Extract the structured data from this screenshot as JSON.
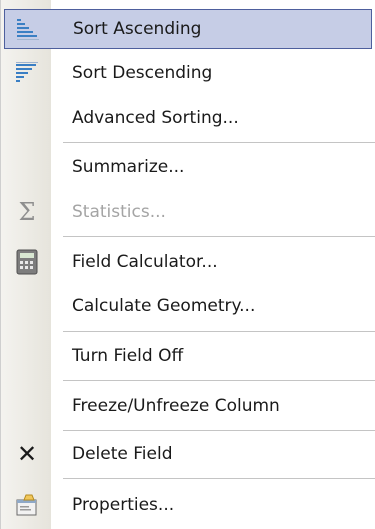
{
  "menu": {
    "items": [
      {
        "label": "Sort Ascending",
        "icon": "sort-ascending-icon"
      },
      {
        "label": "Sort Descending",
        "icon": "sort-descending-icon"
      },
      {
        "label": "Advanced Sorting..."
      },
      {
        "label": "Summarize..."
      },
      {
        "label": "Statistics...",
        "icon": "sigma-icon",
        "disabled": true
      },
      {
        "label": "Field Calculator...",
        "icon": "calculator-icon"
      },
      {
        "label": "Calculate Geometry..."
      },
      {
        "label": "Turn Field Off"
      },
      {
        "label": "Freeze/Unfreeze Column"
      },
      {
        "label": "Delete Field",
        "icon": "delete-icon"
      },
      {
        "label": "Properties...",
        "icon": "properties-icon"
      }
    ]
  },
  "colors": {
    "highlight_fill": "#c6cde6",
    "highlight_border": "#4e5f9d",
    "disabled_text": "#a4a4a4"
  }
}
